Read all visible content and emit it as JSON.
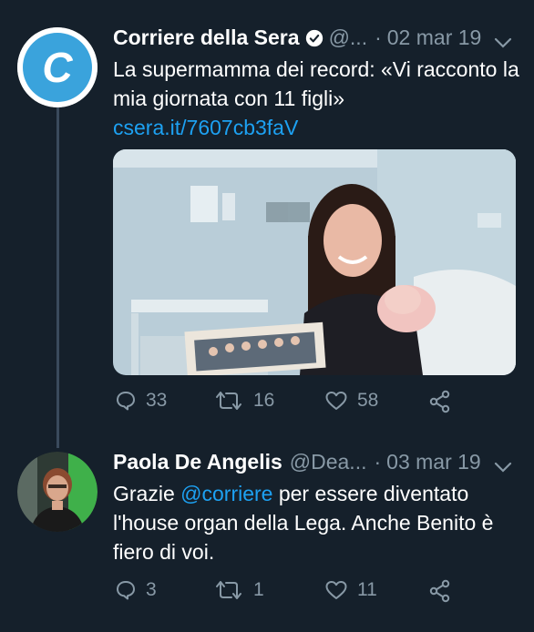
{
  "tweets": [
    {
      "author": "Corriere della Sera",
      "handle": "@...",
      "separator": "·",
      "date": "02 mar 19",
      "text": "La supermamma dei record: «Vi racconto la mia giornata con 11 figli»",
      "link": "csera.it/7607cb3faV",
      "avatar_letter": "C",
      "actions": {
        "replies": "33",
        "retweets": "16",
        "likes": "58"
      }
    },
    {
      "author": "Paola De Angelis",
      "handle": "@Dea...",
      "separator": "·",
      "date": "03 mar 19",
      "text_before": "Grazie ",
      "mention": "@corriere",
      "text_after": " per essere diventato l'house organ della Lega. Anche Benito è fiero di voi.",
      "actions": {
        "replies": "3",
        "retweets": "1",
        "likes": "11"
      }
    }
  ],
  "colors": {
    "background": "#15202b",
    "accent": "#1da1f2",
    "muted": "#8899a6"
  }
}
